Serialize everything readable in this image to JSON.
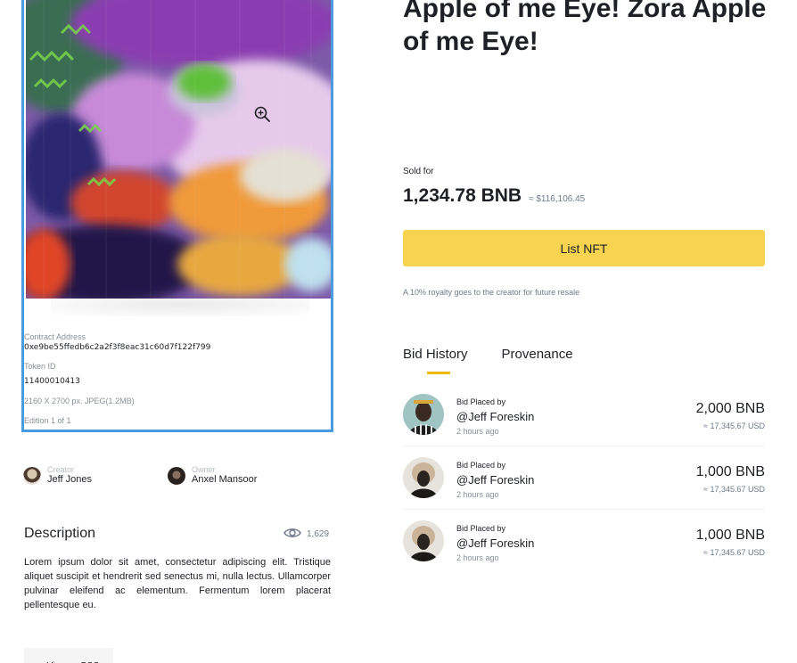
{
  "nft": {
    "title": "Apple of me Eye! Zora Apple of me Eye!",
    "contract_label": "Contract Address",
    "contract_value": "0xe9be55ffedb6c2a2f3f8eac31c60d7f122f799",
    "token_label": "Token ID",
    "token_value": "11400010413",
    "file_info": "2160 X 2700 px. JPEG(1.2MB)",
    "edition": "Edition 1 of 1"
  },
  "people": {
    "creator_role": "Creator",
    "creator_name": "Jeff Jones",
    "owner_role": "Owner",
    "owner_name": "Anxel Mansoor"
  },
  "description": {
    "title": "Description",
    "views": "1,629",
    "text": "Lorem ipsum dolor sit amet, consectetur adipiscing elit. Tristique aliquet suscipit et hendrerit sed senectus mi, nulla lectus. Ullamcorper pulvinar eleifend ac elementum. Fermentum lorem placerat pellentesque eu.",
    "bsc_button": "View on BSC"
  },
  "sale": {
    "sold_label": "Sold for",
    "price": "1,234.78 BNB",
    "usd": "≈ $116,106.45",
    "list_button": "List NFT",
    "royalty_note": "A 10% royalty goes to the creator for future resale"
  },
  "tabs": [
    {
      "label": "Bid History",
      "active": true
    },
    {
      "label": "Provenance",
      "active": false
    }
  ],
  "bids": [
    {
      "placed_label": "Bid Placed by",
      "user": "@Jeff Foreskin",
      "time": "2 hours ago",
      "amount": "2,000 BNB",
      "usd": "≈ 17,345.67 USD"
    },
    {
      "placed_label": "Bid Placed by",
      "user": "@Jeff Foreskin",
      "time": "2 hours ago",
      "amount": "1,000 BNB",
      "usd": "≈ 17,345.67 USD"
    },
    {
      "placed_label": "Bid Placed by",
      "user": "@Jeff Foreskin",
      "time": "2 hours ago",
      "amount": "1,000 BNB",
      "usd": "≈ 17,345.67 USD"
    }
  ],
  "icons": {
    "zoom": "zoom-in-icon",
    "views": "eye-icon"
  },
  "colors": {
    "accent": "#f8d34f",
    "tab_underline": "#f0b90b",
    "selection_border": "#4a9be0"
  }
}
